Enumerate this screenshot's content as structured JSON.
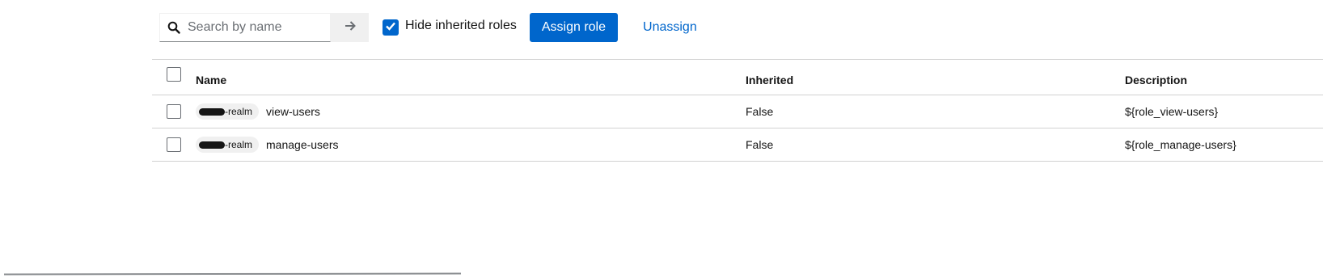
{
  "toolbar": {
    "search_placeholder": "Search by name",
    "hide_inherited_label": "Hide inherited roles",
    "hide_inherited_checked": true,
    "assign_label": "Assign role",
    "unassign_label": "Unassign"
  },
  "table": {
    "columns": [
      "Name",
      "Inherited",
      "Description"
    ],
    "rows": [
      {
        "client": "-realm",
        "role": "view-users",
        "inherited": "False",
        "description": "${role_view-users}"
      },
      {
        "client": "-realm",
        "role": "manage-users",
        "inherited": "False",
        "description": "${role_manage-users}"
      }
    ]
  },
  "colors": {
    "primary": "#0066cc",
    "border": "#d2d2d2",
    "text": "#151515"
  },
  "icons": {
    "search": "search-icon",
    "submit": "arrow-right-icon",
    "check": "checkmark-icon"
  }
}
